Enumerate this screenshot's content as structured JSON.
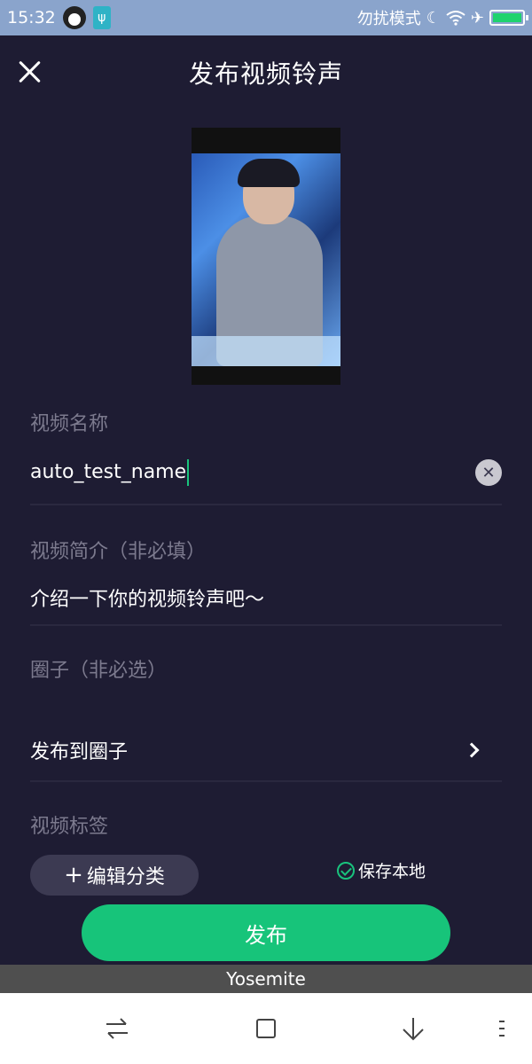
{
  "status_bar": {
    "time": "15:32",
    "mode_text": "勿扰模式",
    "battery_level": 1.0
  },
  "header": {
    "title": "发布视频铃声"
  },
  "form": {
    "video_name_label": "视频名称",
    "video_name_value": "auto_test_name",
    "video_desc_label": "视频简介（非必填）",
    "video_desc_placeholder": "介绍一下你的视频铃声吧～",
    "circle_label": "圈子（非必选）",
    "circle_link_label": "发布到圈子",
    "tags_label": "视频标签",
    "edit_category_label": "编辑分类",
    "save_local_label": "保存本地"
  },
  "actions": {
    "publish_label": "发布"
  },
  "keyboard": {
    "name": "Yosemite"
  },
  "icons": [
    "qq-icon",
    "usb-icon",
    "moon-icon",
    "wifi-icon",
    "airplane-icon",
    "battery-icon",
    "close-icon",
    "clear-icon",
    "chevron-right-icon",
    "check-icon",
    "switch-icon",
    "square-icon",
    "down-icon",
    "menu-icon"
  ],
  "colors": {
    "accent": "#17c47a",
    "background": "#1e1c33",
    "status_bar": "#8aa4cc"
  }
}
